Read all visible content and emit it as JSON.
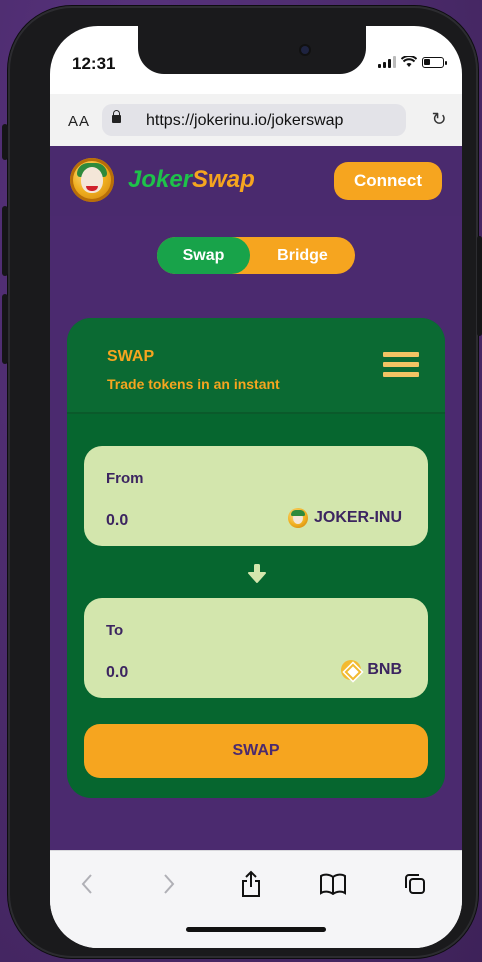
{
  "status_bar": {
    "time": "12:31"
  },
  "browser": {
    "text_size_label": "AA",
    "url": "https://jokerinu.io/jokerswap",
    "reload_icon": "reload-icon"
  },
  "header": {
    "brand_part1": "Joker",
    "brand_part2": "Swap",
    "connect_label": "Connect"
  },
  "mode_toggle": {
    "swap_label": "Swap",
    "bridge_label": "Bridge",
    "active": "Swap"
  },
  "swap_card": {
    "title": "SWAP",
    "subtitle": "Trade tokens in an instant",
    "from": {
      "label": "From",
      "amount": "0.0",
      "token": "JOKER-INU"
    },
    "to": {
      "label": "To",
      "amount": "0.0",
      "token": "BNB"
    },
    "swap_button_label": "SWAP"
  },
  "colors": {
    "purple": "#4b2a6f",
    "green": "#06662f",
    "orange": "#f6a51f",
    "field_bg": "#d3e6ad"
  },
  "toolbar": {
    "icons": [
      "back-icon",
      "forward-icon",
      "share-icon",
      "bookmarks-icon",
      "tabs-icon"
    ]
  }
}
